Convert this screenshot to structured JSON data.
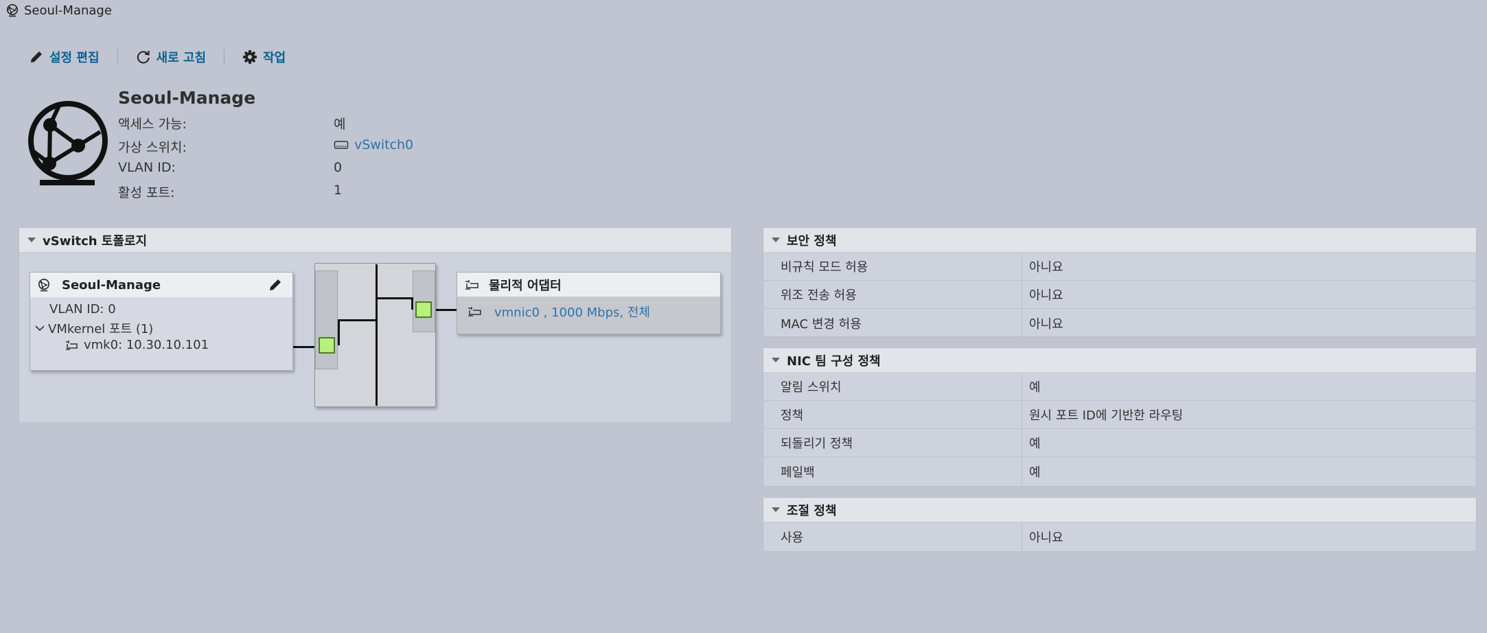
{
  "window": {
    "title": "Seoul-Manage",
    "icon": "network-globe-icon"
  },
  "toolbar": {
    "edit_label": "설정 편집",
    "refresh_label": "새로 고침",
    "actions_label": "작업"
  },
  "header": {
    "title": "Seoul-Manage",
    "icon": "network-globe-icon",
    "properties": [
      {
        "label": "액세스 가능:",
        "value": "예"
      },
      {
        "label": "가상 스위치:",
        "value": "vSwitch0",
        "icon": "switch-icon"
      },
      {
        "label": "VLAN ID:",
        "value": "0"
      },
      {
        "label": "활성 포트:",
        "value": "1"
      }
    ]
  },
  "topology": {
    "title": "vSwitch 토폴로지",
    "portgroup": {
      "name": "Seoul-Manage",
      "vlan": "VLAN ID: 0",
      "vmkernel": "VMkernel 포트 (1)",
      "vmk": "vmk0: 10.30.10.101"
    },
    "adapters": {
      "title": "물리적 어댑터",
      "vmnic": "vmnic0 , 1000 Mbps, 전체"
    }
  },
  "security_policy": {
    "title": "보안 정책",
    "rows": [
      {
        "label": "비규칙 모드 허용",
        "value": "아니요"
      },
      {
        "label": "위조 전송 허용",
        "value": "아니요"
      },
      {
        "label": "MAC 변경 허용",
        "value": "아니요"
      }
    ]
  },
  "nic_teaming": {
    "title": "NIC 팀 구성 정책",
    "rows": [
      {
        "label": "알림 스위치",
        "value": "예"
      },
      {
        "label": "정책",
        "value": "원시 포트 ID에 기반한 라우팅"
      },
      {
        "label": "되돌리기 정책",
        "value": "예"
      },
      {
        "label": "페일백",
        "value": "예"
      }
    ]
  },
  "shaping": {
    "title": "조절 정책",
    "rows": [
      {
        "label": "사용",
        "value": "아니요"
      }
    ]
  },
  "colors": {
    "background": "#c0c5d1",
    "link": "#2e72a9",
    "toolbar_text": "#0b5f93",
    "port_green": "#b7f07a"
  }
}
